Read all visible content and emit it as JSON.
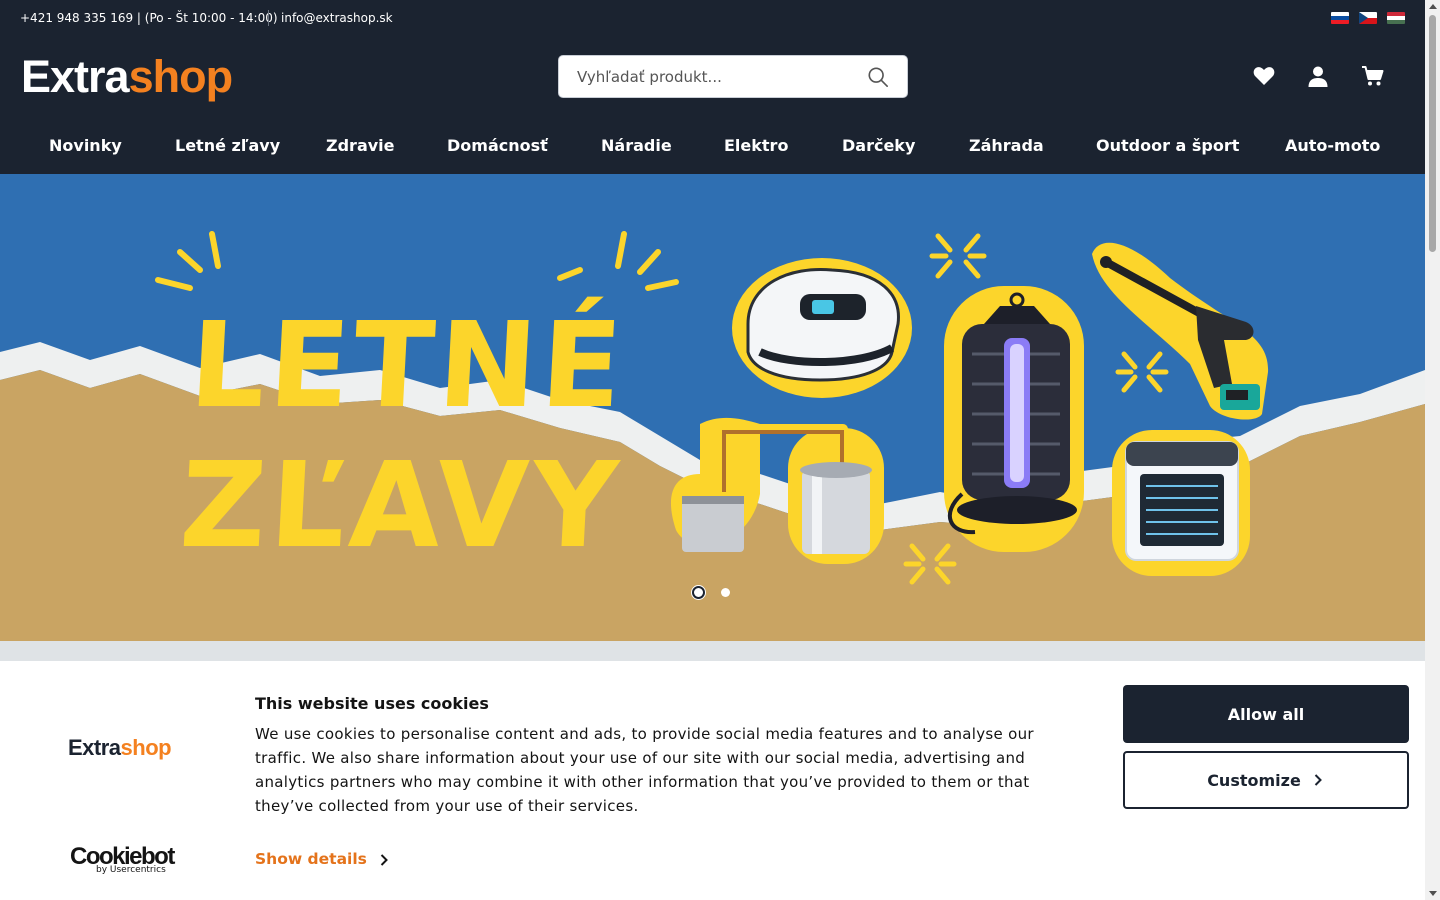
{
  "topbar": {
    "phone": "+421 948 335 169 | (Po - Št 10:00 - 14:00)",
    "email": "info@extrashop.sk",
    "languages": [
      "sk-flag-icon",
      "cz-flag-icon",
      "hu-flag-icon"
    ]
  },
  "header": {
    "logo_part1": "Extra",
    "logo_part2": "shop",
    "search_placeholder": "Vyhľadať produkt...",
    "icons": [
      "heart-icon",
      "user-icon",
      "cart-icon"
    ]
  },
  "nav": {
    "items": [
      "Novinky",
      "Letné zľavy",
      "Zdravie",
      "Domácnosť",
      "Náradie",
      "Elektro",
      "Darčeky",
      "Záhrada",
      "Outdoor a šport",
      "Auto-moto"
    ]
  },
  "hero": {
    "headline_line1": "LETNÉ",
    "headline_line2": "ZĽAVY",
    "slides_count": 2,
    "active_slide": 1
  },
  "cookie": {
    "logo_part1": "Extra",
    "logo_part2": "shop",
    "title": "This website uses cookies",
    "body": "We use cookies to personalise content and ads, to provide social media features and to analyse our traffic. We also share information about your use of our site with our social media, advertising and analytics partners who may combine it with other information that you’ve provided to them or that they’ve collected from your use of their services.",
    "show_details": "Show details",
    "allow_all": "Allow all",
    "customize": "Customize",
    "cookiebot_brand": "Cookiebot",
    "cookiebot_sub": "by Usercentrics"
  },
  "colors": {
    "dark": "#1b2330",
    "accent_orange": "#f48120",
    "hero_yellow": "#fcd52b",
    "hero_blue": "#2f6fb2",
    "sand": "#c9a463"
  }
}
